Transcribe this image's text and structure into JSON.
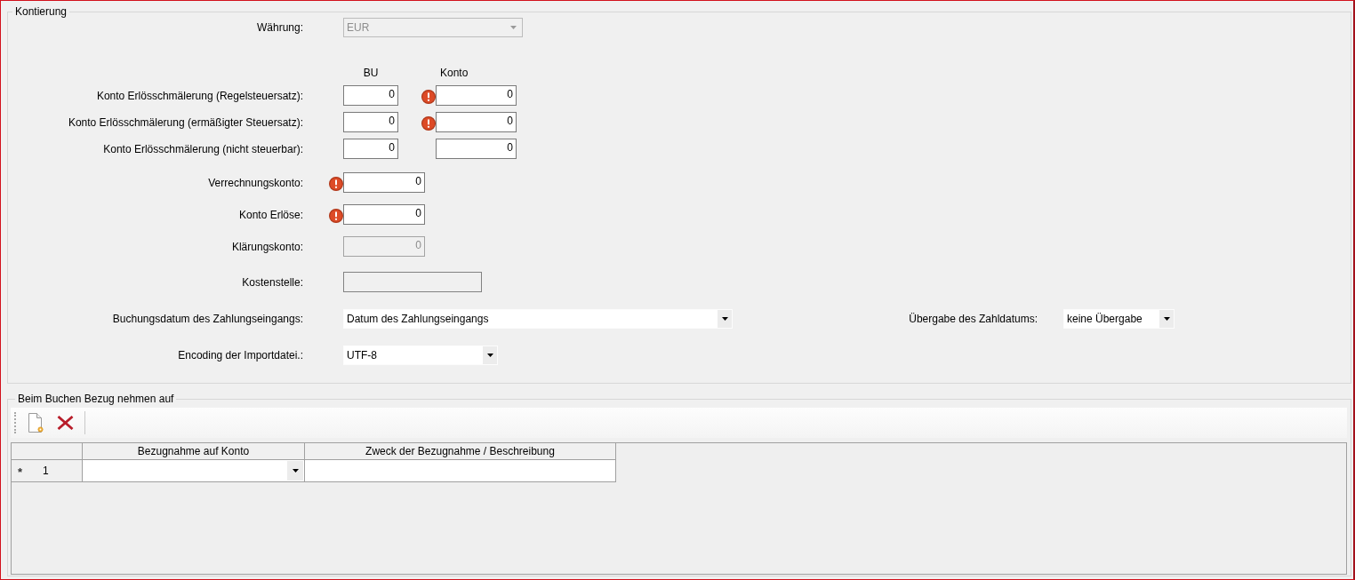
{
  "kontierung": {
    "title": "Kontierung",
    "currency": {
      "label": "Währung:",
      "value": "EUR",
      "disabled": true
    },
    "column_headers": {
      "bu": "BU",
      "konto": "Konto"
    },
    "account_rows": [
      {
        "label": "Konto Erlösschmälerung (Regelsteuersatz):",
        "bu": "0",
        "konto": "0",
        "error": true
      },
      {
        "label": "Konto Erlösschmälerung (ermäßigter Steuersatz):",
        "bu": "0",
        "konto": "0",
        "error": true
      },
      {
        "label": "Konto Erlösschmälerung (nicht steuerbar):",
        "bu": "0",
        "konto": "0",
        "error": false
      }
    ],
    "fields": [
      {
        "kind": "number",
        "label": "Verrechnungskonto:",
        "value": "0",
        "error": true,
        "disabled": false
      },
      {
        "kind": "number",
        "label": "Konto Erlöse:",
        "value": "0",
        "error": true,
        "disabled": false
      },
      {
        "kind": "number",
        "label": "Klärungskonto:",
        "value": "0",
        "error": false,
        "disabled": true
      },
      {
        "kind": "text",
        "label": "Kostenstelle:",
        "disabled": true
      },
      {
        "kind": "select",
        "label": "Buchungsdatum des Zahlungseingangs:",
        "value": "Datum des Zahlungseingangs",
        "side": {
          "label": "Übergabe des Zahldatums:",
          "value": "keine Übergabe"
        }
      },
      {
        "kind": "select",
        "label": "Encoding der Importdatei.:",
        "value": "UTF-8"
      }
    ]
  },
  "bezug": {
    "title": "Beim Buchen Bezug nehmen auf",
    "grid": {
      "columns": [
        {
          "label": "Bezugnahme auf Konto",
          "kind": "select"
        },
        {
          "label": "Zweck der Bezugnahme / Beschreibung",
          "kind": "text"
        }
      ],
      "rows": [
        {
          "marker": "*",
          "number": "1"
        }
      ]
    }
  }
}
